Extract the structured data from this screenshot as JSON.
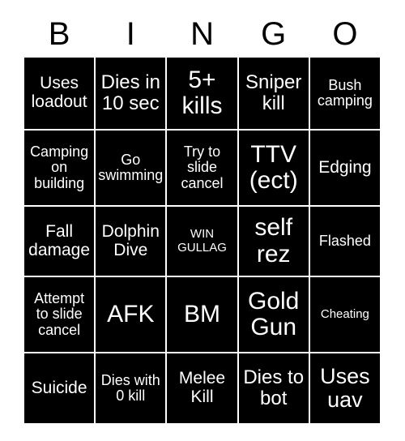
{
  "card": {
    "type": "bingo-card",
    "columns": 5,
    "rows": 5,
    "colors": {
      "cell_background": "#000000",
      "cell_text": "#ffffff",
      "grid_line": "#ffffff",
      "page_background": "#ffffff",
      "header_text": "#000000"
    },
    "header": {
      "letters": [
        "B",
        "I",
        "N",
        "G",
        "O"
      ]
    },
    "cells": [
      [
        {
          "text": "Uses loadout",
          "size": "md"
        },
        {
          "text": "Dies in 10 sec",
          "size": "lg"
        },
        {
          "text": "5+ kills",
          "size": "xxl"
        },
        {
          "text": "Sniper kill",
          "size": "lg"
        },
        {
          "text": "Bush camping",
          "size": "sm"
        }
      ],
      [
        {
          "text": "Camping on building",
          "size": "sm"
        },
        {
          "text": "Go swimming",
          "size": "sm"
        },
        {
          "text": "Try to slide cancel",
          "size": "sm"
        },
        {
          "text": "TTV (ect)",
          "size": "xxl"
        },
        {
          "text": "Edging",
          "size": "md"
        }
      ],
      [
        {
          "text": "Fall damage",
          "size": "md"
        },
        {
          "text": "Dolphin Dive",
          "size": "md"
        },
        {
          "text": "WIN GULLAG",
          "size": "xs"
        },
        {
          "text": "self rez",
          "size": "xxl"
        },
        {
          "text": "Flashed",
          "size": "sm"
        }
      ],
      [
        {
          "text": "Attempt to slide cancel",
          "size": "sm"
        },
        {
          "text": "AFK",
          "size": "xxl"
        },
        {
          "text": "BM",
          "size": "xxl"
        },
        {
          "text": "Gold Gun",
          "size": "xxl"
        },
        {
          "text": "Cheating",
          "size": "xs"
        }
      ],
      [
        {
          "text": "Suicide",
          "size": "md"
        },
        {
          "text": "Dies with 0 kill",
          "size": "sm"
        },
        {
          "text": "Melee Kill",
          "size": "md"
        },
        {
          "text": "Dies to bot",
          "size": "lg"
        },
        {
          "text": "Uses uav",
          "size": "xl"
        }
      ]
    ]
  }
}
